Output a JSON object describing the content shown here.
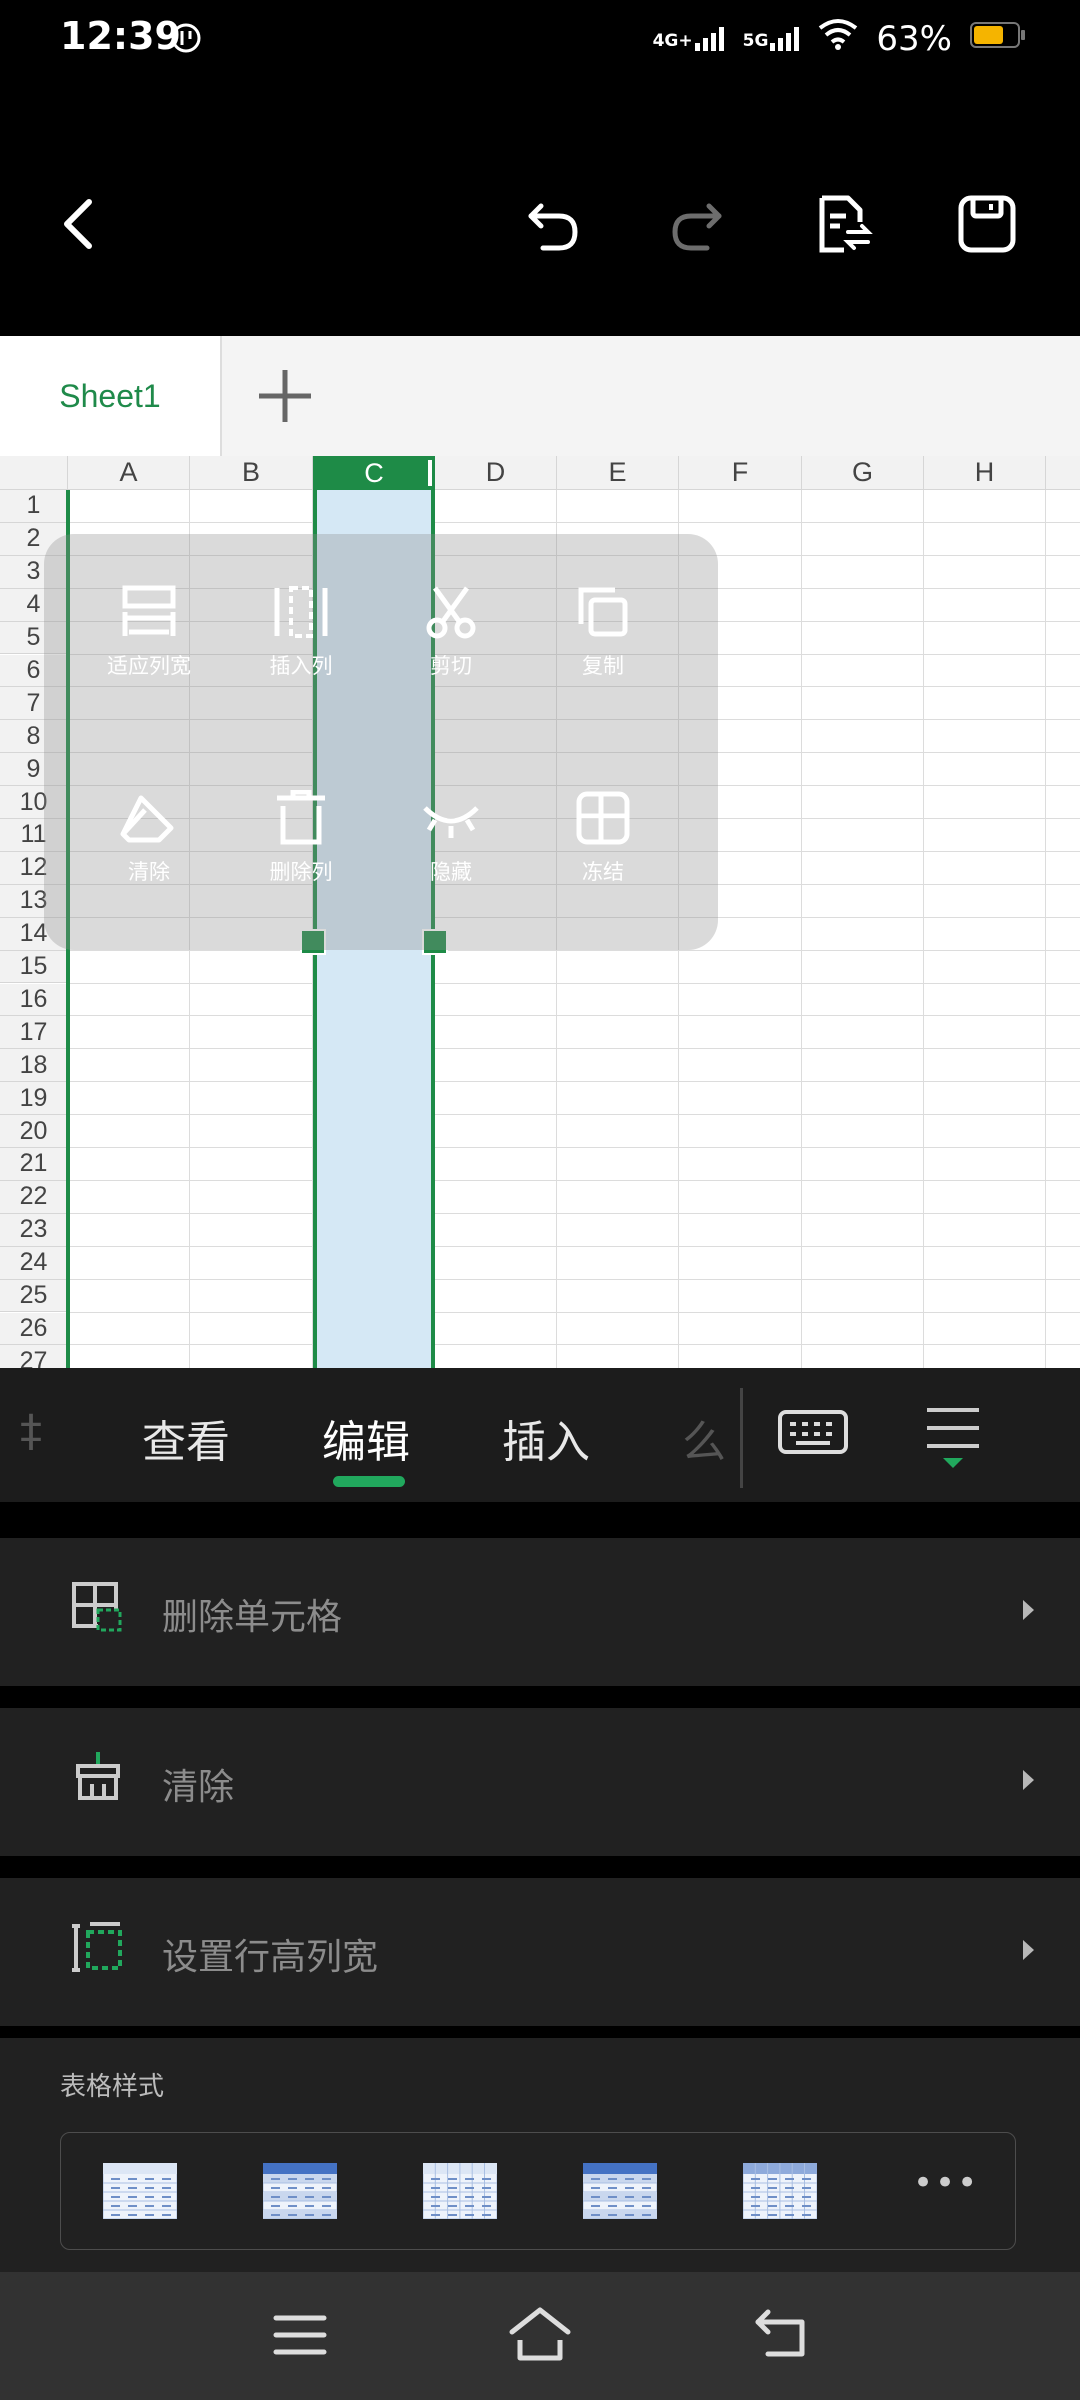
{
  "status": {
    "time": "12:39",
    "network1": "4G+",
    "network2": "5G",
    "battery": "63%"
  },
  "sheet": {
    "tab_name": "Sheet1"
  },
  "grid": {
    "columns": [
      "A",
      "B",
      "C",
      "D",
      "E",
      "F",
      "G",
      "H"
    ],
    "rows": [
      "1",
      "2",
      "3",
      "4",
      "5",
      "6",
      "7",
      "8",
      "9",
      "10",
      "11",
      "12",
      "13",
      "14",
      "15",
      "16",
      "17",
      "18",
      "19",
      "20",
      "21",
      "22",
      "23",
      "24",
      "25",
      "26",
      "27"
    ],
    "selected_column": "C"
  },
  "popup": {
    "items": [
      {
        "label": "适应列宽",
        "icon": "autofit-width-icon"
      },
      {
        "label": "插入列",
        "icon": "insert-column-icon"
      },
      {
        "label": "剪切",
        "icon": "scissors-icon"
      },
      {
        "label": "复制",
        "icon": "copy-icon"
      },
      {
        "label": "清除",
        "icon": "eraser-icon"
      },
      {
        "label": "删除列",
        "icon": "trash-icon"
      },
      {
        "label": "隐藏",
        "icon": "eye-hidden-icon"
      },
      {
        "label": "冻结",
        "icon": "freeze-panes-icon"
      }
    ]
  },
  "ribbon": {
    "tabs": [
      "查看",
      "编辑",
      "插入"
    ],
    "active": "编辑",
    "partial_left": "‡",
    "partial_right": "么"
  },
  "panel": {
    "rows": [
      {
        "label": "删除单元格",
        "icon": "delete-cells-icon"
      },
      {
        "label": "清除",
        "icon": "clear-icon"
      },
      {
        "label": "设置行高列宽",
        "icon": "row-col-size-icon"
      }
    ],
    "style_section_label": "表格样式",
    "more_label": "•••"
  },
  "colors": {
    "accent": "#1e8b47",
    "selection": "#d5e8f5",
    "panel_bg": "#212121"
  }
}
